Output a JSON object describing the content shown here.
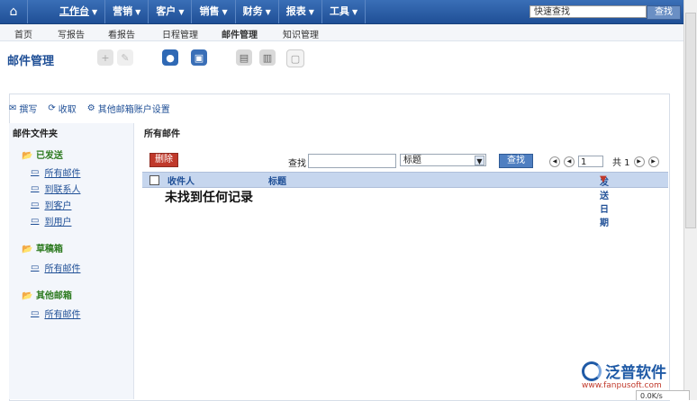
{
  "topbar": {
    "menu": [
      {
        "label": "工作台",
        "active": true
      },
      {
        "label": "营销",
        "active": false
      },
      {
        "label": "客户",
        "active": false
      },
      {
        "label": "销售",
        "active": false
      },
      {
        "label": "财务",
        "active": false
      },
      {
        "label": "报表",
        "active": false
      },
      {
        "label": "工具",
        "active": false
      }
    ],
    "quick_search_placeholder": "快速查找",
    "quick_search_button": "查找"
  },
  "subnav": [
    {
      "label": "首页",
      "active": false
    },
    {
      "label": "写报告",
      "active": false
    },
    {
      "label": "看报告",
      "active": false
    },
    {
      "label": "日程管理",
      "active": false
    },
    {
      "label": "邮件管理",
      "active": true
    },
    {
      "label": "知识管理",
      "active": false
    }
  ],
  "page_title": "邮件管理",
  "mail_toolbar": {
    "compose": "撰写",
    "receive": "收取",
    "other_accounts": "其他邮箱账户设置"
  },
  "folders": {
    "header": "邮件文件夹",
    "groups": [
      {
        "name": "已发送",
        "items": [
          "所有邮件",
          "到联系人",
          "到客户",
          "到用户"
        ]
      },
      {
        "name": "草稿箱",
        "items": [
          "所有邮件"
        ]
      },
      {
        "name": "其他邮箱",
        "items": [
          "所有邮件"
        ]
      }
    ]
  },
  "main": {
    "header": "所有邮件",
    "delete_button": "删除",
    "find_label": "查找",
    "find_input_value": "",
    "find_field_selected": "标题",
    "find_button": "查找",
    "pager": {
      "current_page": "1",
      "total_label": "共 1"
    },
    "columns": {
      "recipient": "收件人",
      "title": "标题",
      "send_date": "发送日期"
    },
    "empty_message": "未找到任何记录"
  },
  "branding": {
    "name": "泛普软件",
    "url": "www.fanpusoft.com"
  },
  "status_widget": "0.0K/s"
}
